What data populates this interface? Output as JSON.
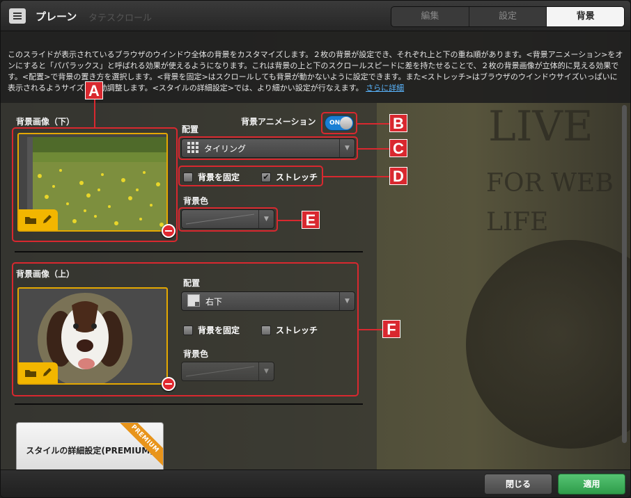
{
  "window": {
    "title": "プレーン",
    "ghost_title": "タテスクロール"
  },
  "tabs": [
    "編集",
    "設定",
    "背景"
  ],
  "description": {
    "text": "このスライドが表示されているブラウザのウインドウ全体の背景をカスタマイズします。２枚の背景が設定でき、それぞれ上と下の重ね順があります。<背景アニメーション>をオンにすると「パパラックス」と呼ばれる効果が使えるようになります。これは背景の上と下のスクロールスピードに差を持たせることで、２枚の背景画像が立体的に見える効果です。<配置>で背景の置き方を選択します。<背景を固定>はスクロールしても背景が動かないように設定できます。また<ストレッチ>はブラウザのウインドウサイズいっぱいに表示されるようサイズを自動調整します。<スタイルの詳細設定>では、より細かい設定が行なえます。",
    "link": "さらに詳細"
  },
  "bottom_image": {
    "label": "背景画像（下）",
    "animation_label": "背景アニメーション",
    "animation_state": "ON",
    "layout_label": "配置",
    "layout_value": "タイリング",
    "fixed_label": "背景を固定",
    "fixed_checked": false,
    "stretch_label": "ストレッチ",
    "stretch_checked": true,
    "color_label": "背景色"
  },
  "top_image": {
    "label": "背景画像（上）",
    "layout_label": "配置",
    "layout_value": "右下",
    "fixed_label": "背景を固定",
    "fixed_checked": false,
    "stretch_label": "ストレッチ",
    "stretch_checked": false,
    "color_label": "背景色"
  },
  "premium": {
    "label": "スタイルの詳細設定(PREMIUM)",
    "ribbon": "PREMIUM"
  },
  "buttons": {
    "close": "閉じる",
    "apply": "適用"
  },
  "annotations": [
    "A",
    "B",
    "C",
    "D",
    "E",
    "F"
  ],
  "background_preview": {
    "line1": "LIVE",
    "line2": "FOR WEB",
    "line3": "LIFE"
  },
  "colors": {
    "accent_yellow": "#f2b600",
    "annotation_red": "#d9282f",
    "toggle_blue": "#1a7fd4",
    "apply_green": "#3aab57"
  }
}
